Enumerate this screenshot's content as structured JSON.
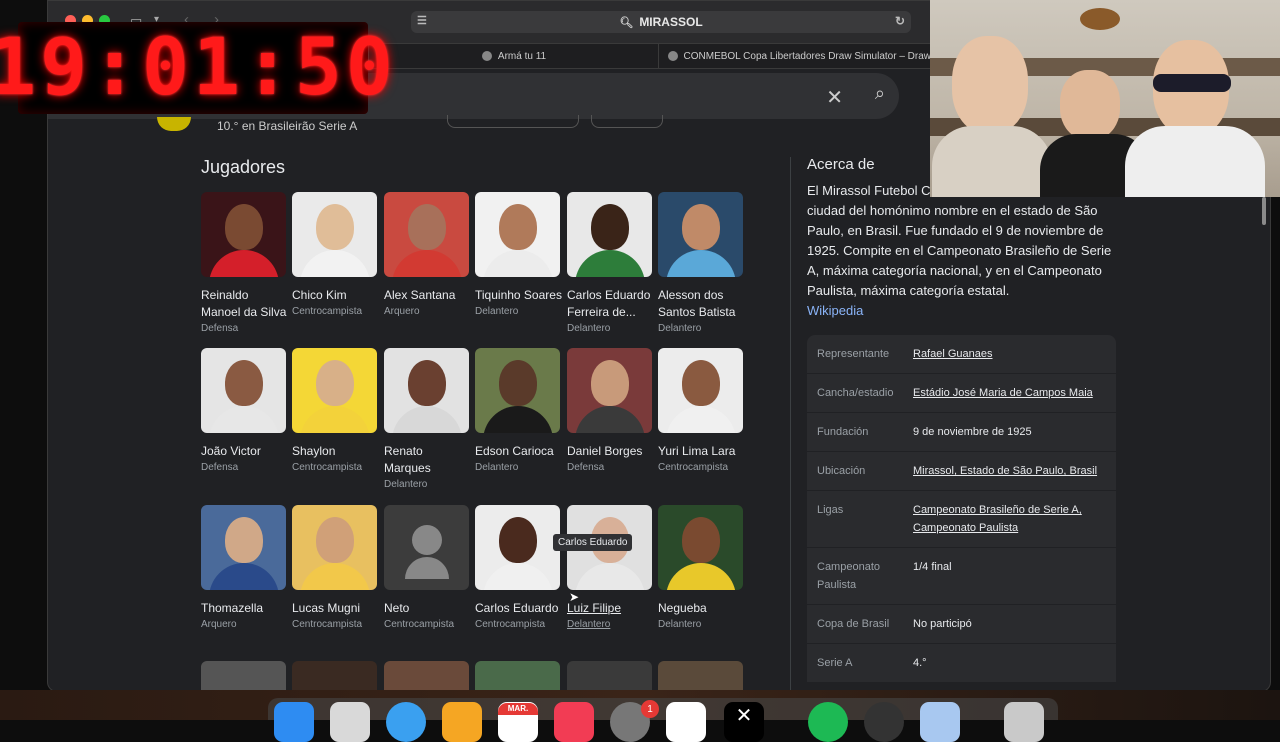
{
  "browser": {
    "address": "MIRASSOL",
    "tabs": [
      {
        "label": "Armá tu 11"
      },
      {
        "label": "CONMEBOL Copa Libertadores Draw Simulator – Draw S"
      }
    ]
  },
  "clock": {
    "time": "19:01:50"
  },
  "peek": {
    "text": "10.° en Brasileirão Serie A"
  },
  "players_section": {
    "title": "Jugadores",
    "tooltip": "Carlos Eduardo",
    "players": [
      {
        "name": "Reinaldo Manoel da Silva",
        "role": "Defensa",
        "skin": "#7a4a32",
        "shirt": "#d41f2a",
        "bg": "#3a1418"
      },
      {
        "name": "Chico Kim",
        "role": "Centrocampista",
        "skin": "#e0bd98",
        "shirt": "#f2f2f2",
        "bg": "#eaeaea"
      },
      {
        "name": "Alex Santana",
        "role": "Arquero",
        "skin": "#a8705a",
        "shirt": "#d23a32",
        "bg": "#c94a40"
      },
      {
        "name": "Tiquinho Soares",
        "role": "Delantero",
        "skin": "#b07a5a",
        "shirt": "#ececec",
        "bg": "#f1f1f1"
      },
      {
        "name": "Carlos Eduardo Ferreira de...",
        "role": "Delantero",
        "skin": "#3a2418",
        "shirt": "#2d7d3a",
        "bg": "#e8e8e8"
      },
      {
        "name": "Alesson dos Santos Batista",
        "role": "Delantero",
        "skin": "#c08a68",
        "shirt": "#5aa8d8",
        "bg": "#2a4a6a"
      },
      {
        "name": "João Victor",
        "role": "Defensa",
        "skin": "#8a5a42",
        "shirt": "#e7e7e7",
        "bg": "#e5e5e5"
      },
      {
        "name": "Shaylon",
        "role": "Centrocampista",
        "skin": "#d8b088",
        "shirt": "#f3d23a",
        "bg": "#f4d736"
      },
      {
        "name": "Renato Marques",
        "role": "Delantero",
        "skin": "#6a4030",
        "shirt": "#d8d8d8",
        "bg": "#e2e2e2"
      },
      {
        "name": "Edson Carioca",
        "role": "Delantero",
        "skin": "#5a3a2a",
        "shirt": "#1a1a1a",
        "bg": "#6a7a4a"
      },
      {
        "name": "Daniel Borges",
        "role": "Defensa",
        "skin": "#c89a7a",
        "shirt": "#3a3a3a",
        "bg": "#7a3a3a"
      },
      {
        "name": "Yuri Lima Lara",
        "role": "Centrocampista",
        "skin": "#8a5a40",
        "shirt": "#f0f0f0",
        "bg": "#ececec"
      },
      {
        "name": "Thomazella",
        "role": "Arquero",
        "skin": "#d0a888",
        "shirt": "#2a4a8a",
        "bg": "#4a6a9a"
      },
      {
        "name": "Lucas Mugni",
        "role": "Centrocampista",
        "skin": "#d0a078",
        "shirt": "#f2c84a",
        "bg": "#e8c060"
      },
      {
        "name": "Neto",
        "role": "Centrocampista",
        "skin": "#888888",
        "shirt": "#888888",
        "bg": "#3c3c3c"
      },
      {
        "name": "Carlos Eduardo",
        "role": "Centrocampista",
        "skin": "#4a2a1e",
        "shirt": "#f0f0f0",
        "bg": "#ececec"
      },
      {
        "name": "Luiz Filipe",
        "role": "Delantero",
        "skin": "#d8b098",
        "shirt": "#e8e8e8",
        "bg": "#e0e0e0"
      },
      {
        "name": "Negueba",
        "role": "Delantero",
        "skin": "#7a4a30",
        "shirt": "#e8c82a",
        "bg": "#2a4a2a"
      }
    ]
  },
  "about": {
    "title": "Acerca de",
    "description": "El Mirassol Futebol Clube es un club de fútbol de la ciudad del homónimo nombre en el estado de São Paulo, en Brasil. Fue fundado el 9 de noviembre de 1925. Compite en el Campeonato Brasileño de Serie A, máxima categoría nacional, y en el Campeonato Paulista, máxima categoría estatal.",
    "link": "Wikipedia",
    "facts": [
      {
        "key": "Representante",
        "value": "Rafael Guanaes",
        "link": true
      },
      {
        "key": "Cancha/estadio",
        "value": "Estádio José Maria de Campos Maia",
        "link": true
      },
      {
        "key": "Fundación",
        "value": "9 de noviembre de 1925",
        "link": false
      },
      {
        "key": "Ubicación",
        "value": "Mirassol, Estado de São Paulo, Brasil",
        "link": true
      },
      {
        "key": "Ligas",
        "value": "Campeonato Brasileño de Serie A, Campeonato Paulista",
        "link": true
      },
      {
        "key": "Campeonato Paulista",
        "value": "1/4 final",
        "link": false
      },
      {
        "key": "Copa de Brasil",
        "value": "No participó",
        "link": false
      },
      {
        "key": "Serie A",
        "value": "4.°",
        "link": false
      }
    ]
  },
  "dock": {
    "calendar_month": "MAR.",
    "badge": "1"
  },
  "colors": {
    "link": "#8ab4f8",
    "clock": "#ff1a1a"
  }
}
